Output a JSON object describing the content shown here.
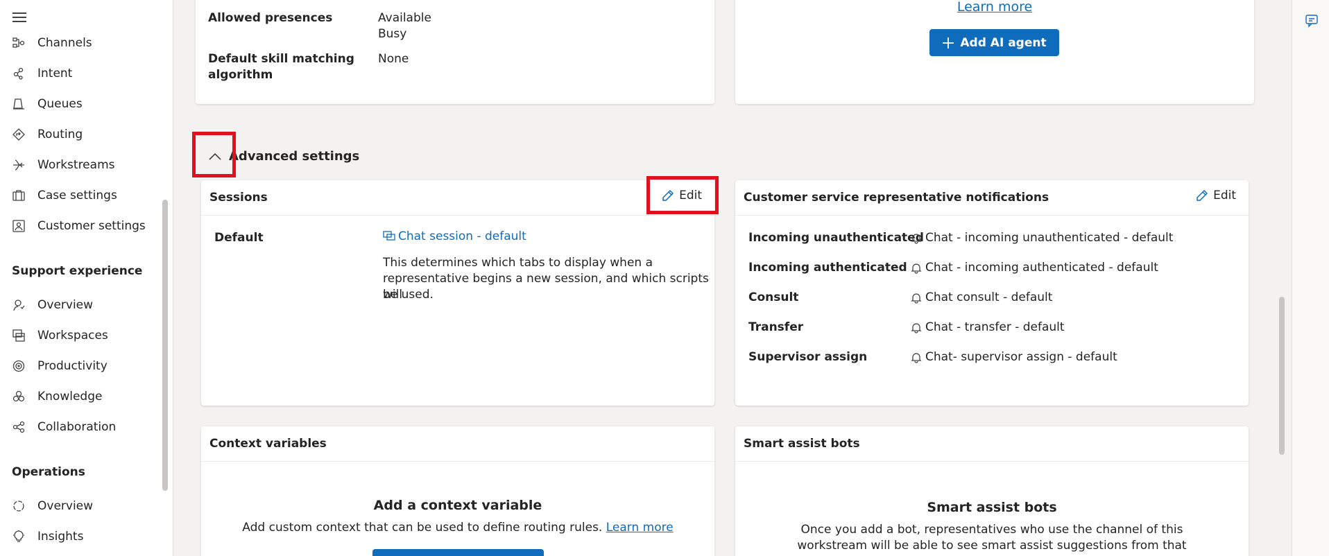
{
  "sidebar": {
    "items_top": [
      {
        "label": "Channels",
        "icon": "channels-icon"
      },
      {
        "label": "Intent",
        "icon": "intent-icon"
      },
      {
        "label": "Queues",
        "icon": "queues-icon"
      },
      {
        "label": "Routing",
        "icon": "routing-icon"
      },
      {
        "label": "Workstreams",
        "icon": "workstreams-icon"
      },
      {
        "label": "Case settings",
        "icon": "case-settings-icon"
      },
      {
        "label": "Customer settings",
        "icon": "customer-settings-icon"
      }
    ],
    "section_support": "Support experience",
    "items_support": [
      {
        "label": "Overview",
        "icon": "overview-icon"
      },
      {
        "label": "Workspaces",
        "icon": "workspaces-icon"
      },
      {
        "label": "Productivity",
        "icon": "productivity-icon"
      },
      {
        "label": "Knowledge",
        "icon": "knowledge-icon"
      },
      {
        "label": "Collaboration",
        "icon": "collaboration-icon"
      }
    ],
    "section_operations": "Operations",
    "items_operations": [
      {
        "label": "Overview",
        "icon": "overview-icon"
      },
      {
        "label": "Insights",
        "icon": "insights-icon"
      }
    ]
  },
  "top_left_card": {
    "rows": [
      {
        "label": "Allowed presences",
        "value_lines": [
          "Available",
          "Busy"
        ]
      },
      {
        "label_lines": [
          "Default skill matching",
          "algorithm"
        ],
        "value": "None"
      }
    ]
  },
  "top_right_card": {
    "learn_more": "Learn more",
    "add_button": "Add AI agent"
  },
  "advanced": {
    "title": "Advanced settings"
  },
  "sessions": {
    "title": "Sessions",
    "edit": "Edit",
    "default_label": "Default",
    "session_link": "Chat session - default",
    "description_lines": [
      "This determines which tabs to display when a",
      "representative begins a new session, and which scripts will",
      "be used."
    ]
  },
  "notifications": {
    "title": "Customer service representative notifications",
    "edit": "Edit",
    "rows": [
      {
        "label": "Incoming unauthenticated",
        "value": "Chat - incoming unauthenticated - default"
      },
      {
        "label": "Incoming authenticated",
        "value": "Chat - incoming authenticated - default"
      },
      {
        "label": "Consult",
        "value": "Chat consult - default"
      },
      {
        "label": "Transfer",
        "value": "Chat - transfer - default"
      },
      {
        "label": "Supervisor assign",
        "value": "Chat- supervisor assign - default"
      }
    ]
  },
  "context_variables": {
    "title": "Context variables",
    "empty_title": "Add a context variable",
    "empty_text": "Add custom context that can be used to define routing rules.",
    "learn_more": "Learn more"
  },
  "smart_assist": {
    "title": "Smart assist bots",
    "empty_title": "Smart assist bots",
    "empty_lines": [
      "Once you add a bot, representatives who use the channel of this",
      "workstream will be able to see smart assist suggestions from that"
    ]
  },
  "colors": {
    "accent": "#0f6cbd",
    "highlight": "#e0101f"
  }
}
